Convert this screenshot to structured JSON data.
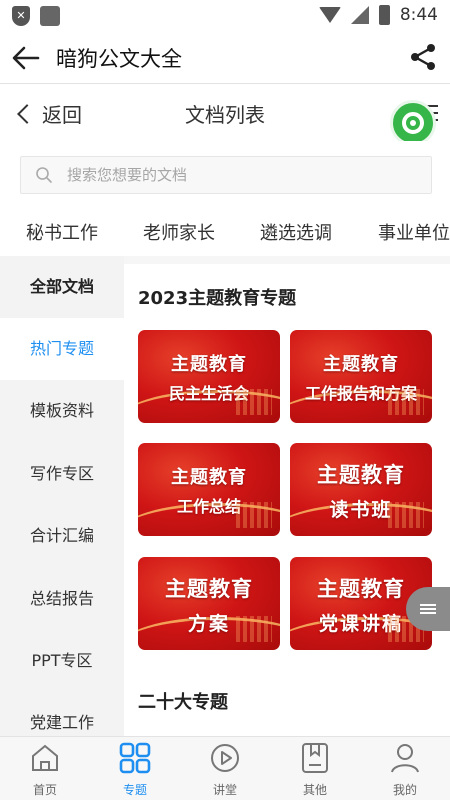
{
  "status_bar": {
    "time": "8:44"
  },
  "app_bar": {
    "title": "暗狗公文大全"
  },
  "nav": {
    "back_label": "返回",
    "title": "文档列表"
  },
  "search": {
    "placeholder": "搜索您想要的文档"
  },
  "category_tabs": [
    "秘书工作",
    "老师家长",
    "遴选选调",
    "事业单位"
  ],
  "sidebar": {
    "items": [
      "全部文档",
      "热门专题",
      "模板资料",
      "写作专区",
      "合计汇编",
      "总结报告",
      "PPT专区",
      "党建工作"
    ],
    "active_index": 1
  },
  "main": {
    "section1_title": "2023主题教育专题",
    "cards": [
      {
        "line1": "主题教育",
        "line2": "民主生活会"
      },
      {
        "line1": "主题教育",
        "line2": "工作报告和方案"
      },
      {
        "line1": "主题教育",
        "line2": "工作总结"
      },
      {
        "line1": "主题教育",
        "line2": "读书班"
      },
      {
        "line1": "主题教育",
        "line2": "方案"
      },
      {
        "line1": "主题教育",
        "line2": "党课讲稿"
      }
    ],
    "section2_title": "二十大专题"
  },
  "bottom_nav": {
    "items": [
      {
        "label": "首页",
        "icon": "home-icon"
      },
      {
        "label": "专题",
        "icon": "grid-icon"
      },
      {
        "label": "讲堂",
        "icon": "play-icon"
      },
      {
        "label": "其他",
        "icon": "bookmark-icon"
      },
      {
        "label": "我的",
        "icon": "user-icon"
      }
    ],
    "active_index": 1
  },
  "colors": {
    "accent": "#1e8ff0",
    "card_red": "#cf1515",
    "fab_green": "#36b648"
  }
}
